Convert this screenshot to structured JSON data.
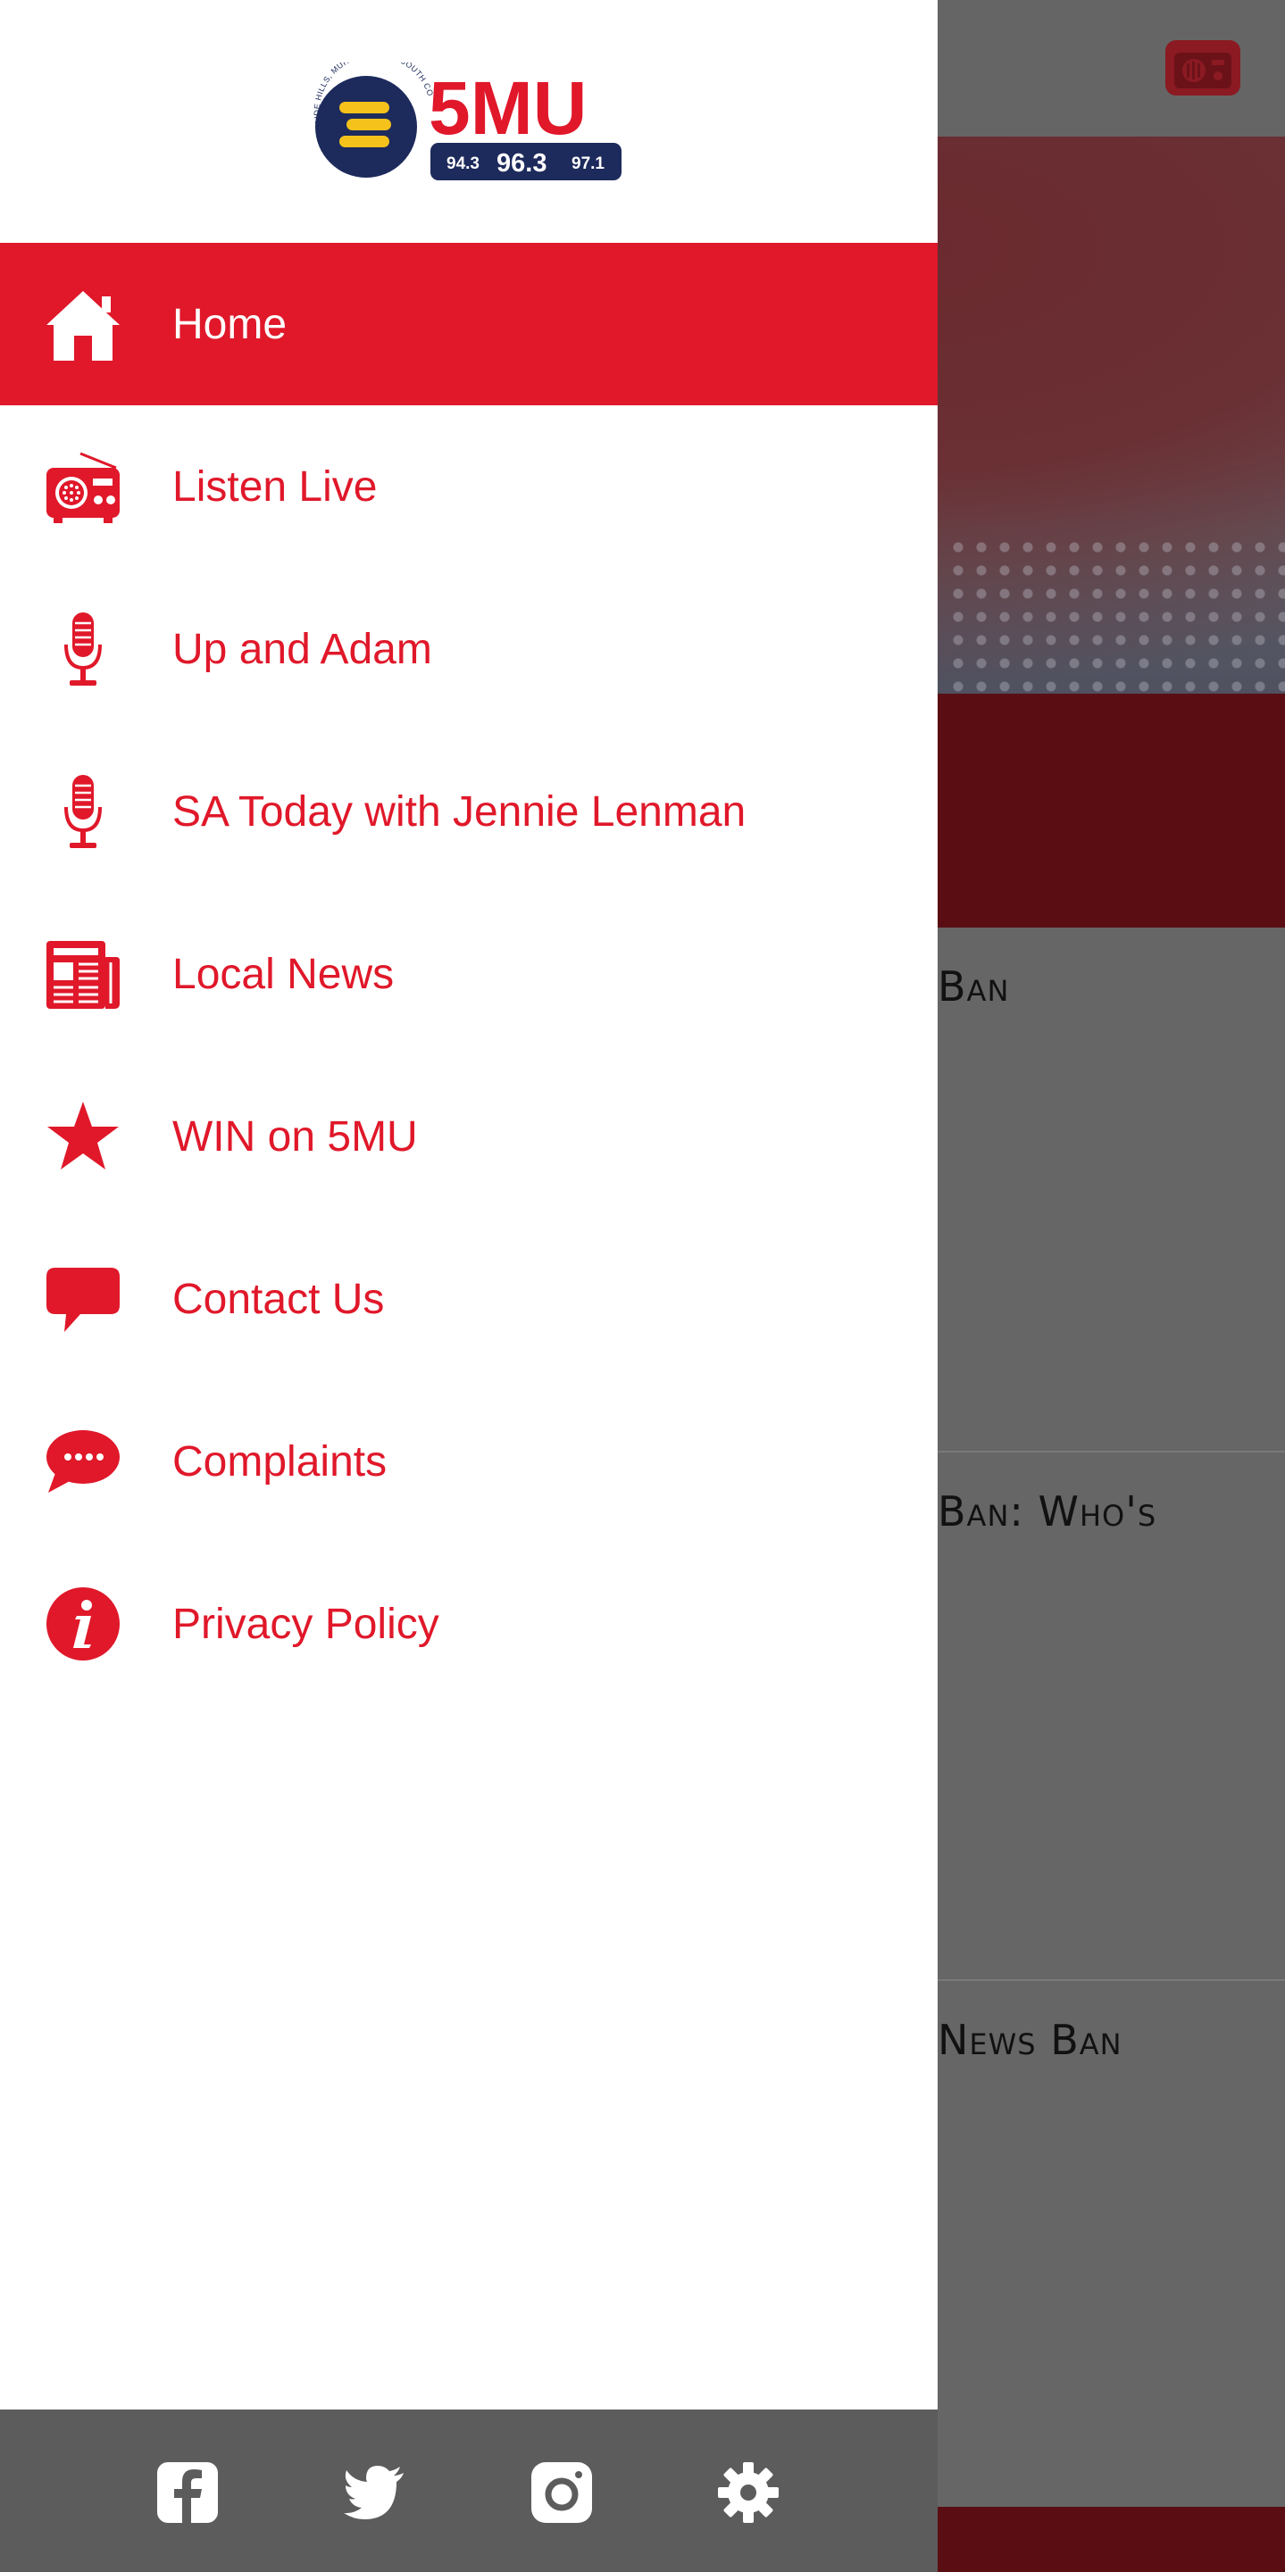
{
  "brand": {
    "name": "5MU",
    "tagline": "ADELAIDE HILLS, MURRAYLANDS, SOUTH COAST",
    "frequencies": [
      "94.3",
      "96.3",
      "97.1"
    ],
    "accent_color": "#e0182a",
    "navy_color": "#1d2a5c",
    "yellow_color": "#f4c21b"
  },
  "menu": {
    "items": [
      {
        "label": "Home",
        "icon": "home-icon",
        "active": true
      },
      {
        "label": "Listen Live",
        "icon": "radio-icon"
      },
      {
        "label": "Up and Adam",
        "icon": "microphone-icon"
      },
      {
        "label": "SA Today with Jennie Lenman",
        "icon": "microphone-icon"
      },
      {
        "label": "Local News",
        "icon": "newspaper-icon"
      },
      {
        "label": "WIN on 5MU",
        "icon": "star-icon"
      },
      {
        "label": "Contact Us",
        "icon": "speech-bubble-icon"
      },
      {
        "label": "Complaints",
        "icon": "chat-dots-icon"
      },
      {
        "label": "Privacy Policy",
        "icon": "info-icon"
      }
    ]
  },
  "footer": {
    "icons": [
      "facebook-icon",
      "twitter-icon",
      "instagram-icon",
      "settings-icon"
    ]
  },
  "background": {
    "card_titles": [
      "Ban",
      "Ban: Who's",
      "News Ban"
    ]
  }
}
